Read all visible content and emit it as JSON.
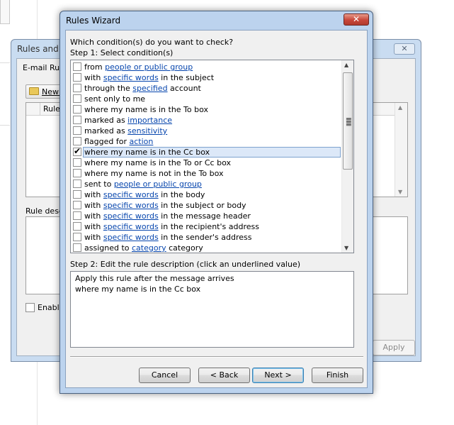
{
  "background_window": {
    "title": "Rules and A",
    "tab_label": "E-mail Rule",
    "new_rule_label": "New R",
    "rule_column_label": "Rule (",
    "description_label": "Rule descr",
    "enable_label": "Enable",
    "apply_label": "Apply"
  },
  "wizard": {
    "title": "Rules Wizard",
    "close_glyph": "✕",
    "question": "Which condition(s) do you want to check?",
    "step1_label": "Step 1: Select condition(s)",
    "conditions": [
      {
        "pre": "from ",
        "link": "people or public group",
        "post": "",
        "checked": false
      },
      {
        "pre": "with ",
        "link": "specific words",
        "post": " in the subject",
        "checked": false
      },
      {
        "pre": "through the ",
        "link": "specified",
        "post": " account",
        "checked": false
      },
      {
        "pre": "sent only to me",
        "link": "",
        "post": "",
        "checked": false
      },
      {
        "pre": "where my name is in the To box",
        "link": "",
        "post": "",
        "checked": false
      },
      {
        "pre": "marked as ",
        "link": "importance",
        "post": "",
        "checked": false
      },
      {
        "pre": "marked as ",
        "link": "sensitivity",
        "post": "",
        "checked": false
      },
      {
        "pre": "flagged for ",
        "link": "action",
        "post": "",
        "checked": false
      },
      {
        "pre": "where my name is in the Cc box",
        "link": "",
        "post": "",
        "checked": true,
        "selected": true
      },
      {
        "pre": "where my name is in the To or Cc box",
        "link": "",
        "post": "",
        "checked": false
      },
      {
        "pre": "where my name is not in the To box",
        "link": "",
        "post": "",
        "checked": false
      },
      {
        "pre": "sent to ",
        "link": "people or public group",
        "post": "",
        "checked": false
      },
      {
        "pre": "with ",
        "link": "specific words",
        "post": " in the body",
        "checked": false
      },
      {
        "pre": "with ",
        "link": "specific words",
        "post": " in the subject or body",
        "checked": false
      },
      {
        "pre": "with ",
        "link": "specific words",
        "post": " in the message header",
        "checked": false
      },
      {
        "pre": "with ",
        "link": "specific words",
        "post": " in the recipient's address",
        "checked": false
      },
      {
        "pre": "with ",
        "link": "specific words",
        "post": " in the sender's address",
        "checked": false
      },
      {
        "pre": "assigned to ",
        "link": "category",
        "post": " category",
        "checked": false
      }
    ],
    "step2_label": "Step 2: Edit the rule description (click an underlined value)",
    "description_lines": [
      "Apply this rule after the message arrives",
      "where my name is in the Cc box"
    ],
    "buttons": {
      "cancel": "Cancel",
      "back": "< Back",
      "next": "Next >",
      "finish": "Finish"
    }
  },
  "colors": {
    "link": "#0645ad",
    "selection": "#dce8f8",
    "close_button": "#c8473a"
  }
}
